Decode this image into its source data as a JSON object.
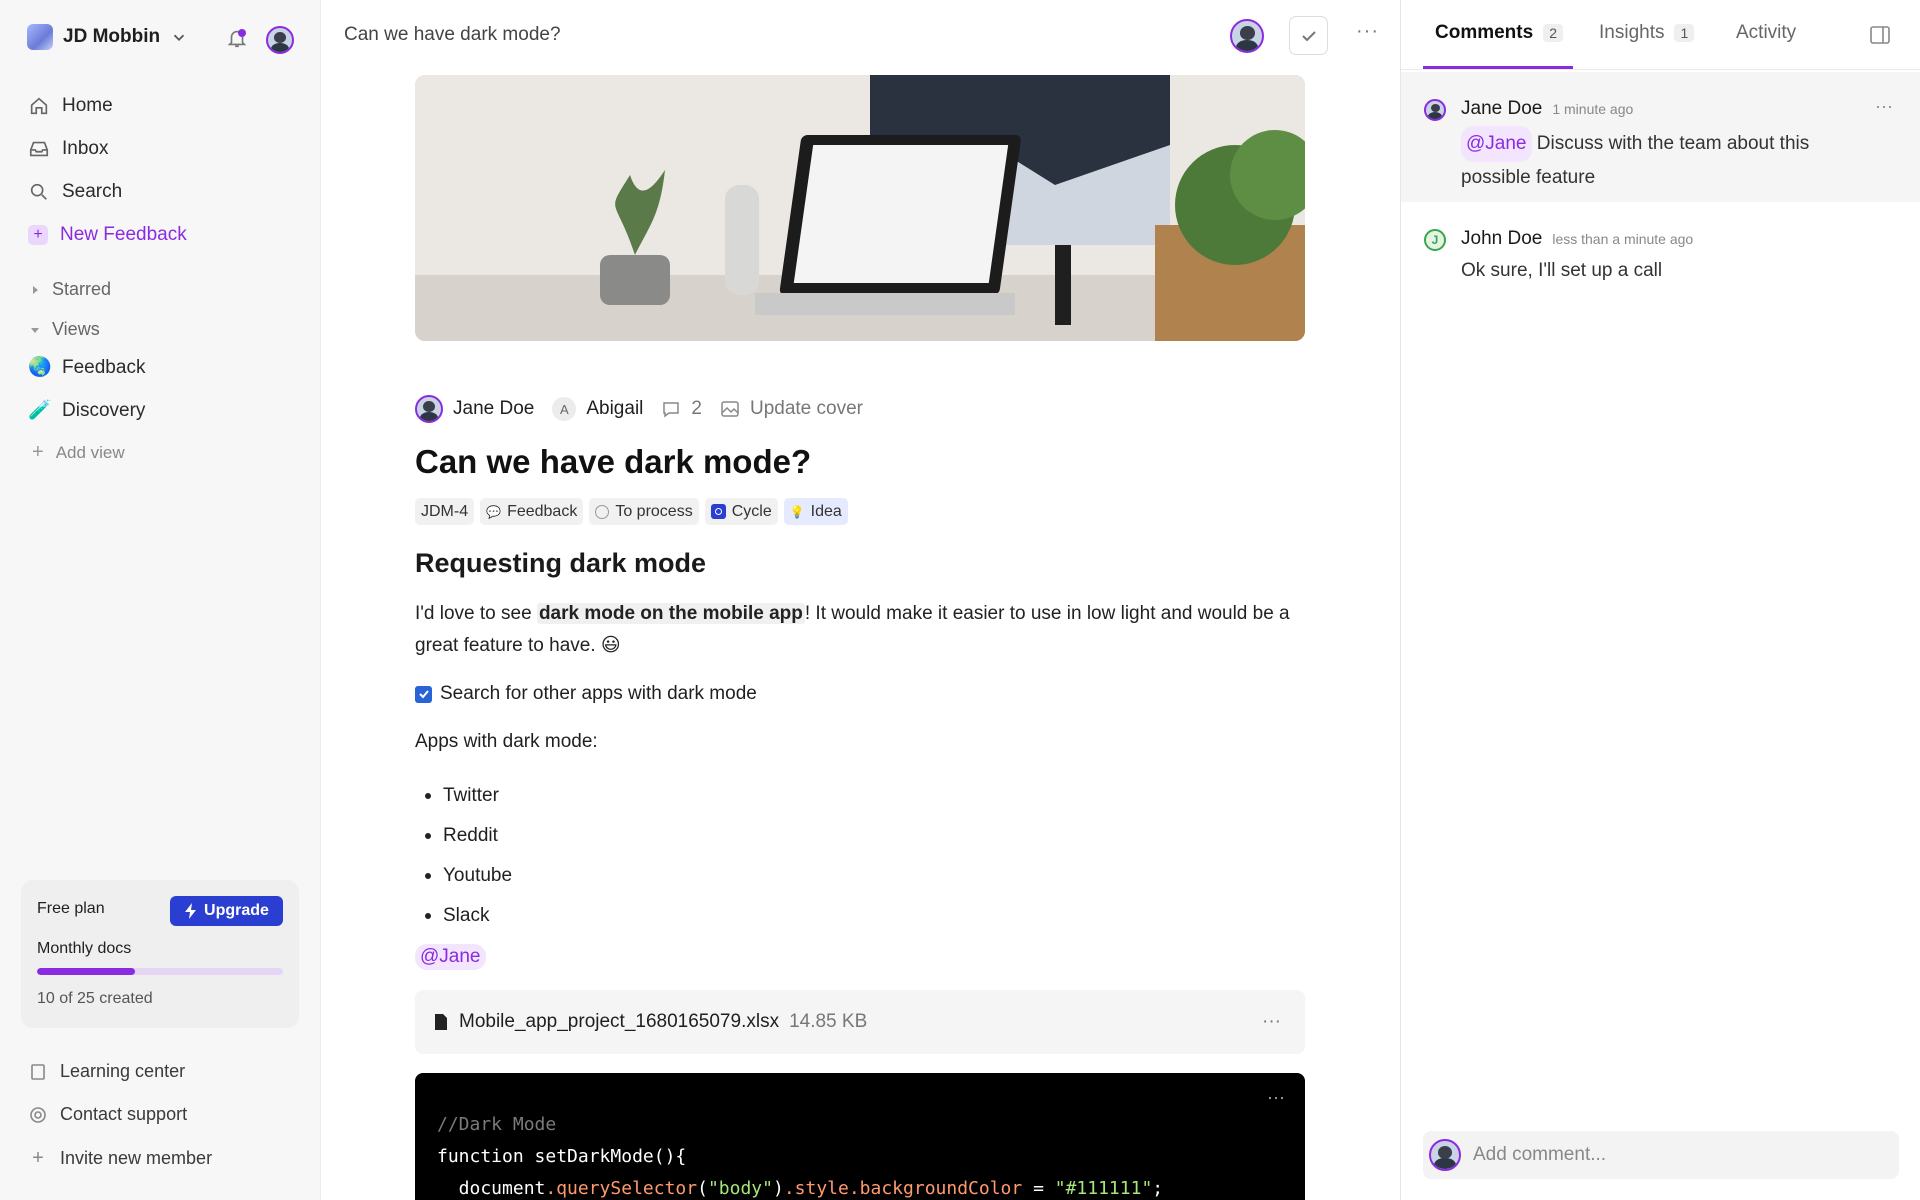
{
  "sidebar": {
    "workspace": "JD Mobbin",
    "nav": [
      {
        "label": "Home",
        "icon": "home-icon"
      },
      {
        "label": "Inbox",
        "icon": "inbox-icon"
      },
      {
        "label": "Search",
        "icon": "search-icon"
      },
      {
        "label": "New Feedback",
        "icon": "plus-icon"
      }
    ],
    "starred": "Starred",
    "views": "Views",
    "view_items": [
      {
        "label": "Feedback",
        "emoji": "🌏"
      },
      {
        "label": "Discovery",
        "emoji": "🧪"
      }
    ],
    "add_view": "Add view",
    "plan": {
      "title": "Free plan",
      "upgrade": "Upgrade",
      "label": "Monthly docs",
      "count": "10 of 25 created",
      "progress": 0.4
    },
    "footer": [
      {
        "label": "Learning center",
        "icon": "book-icon"
      },
      {
        "label": "Contact support",
        "icon": "support-icon"
      },
      {
        "label": "Invite new member",
        "icon": "plus-icon"
      }
    ]
  },
  "main": {
    "topbar_title": "Can we have dark mode?",
    "meta": {
      "author": "Jane Doe",
      "assignee_initial": "A",
      "assignee": "Abigail",
      "comments": "2",
      "cover": "Update cover"
    },
    "title": "Can we have dark mode?",
    "tags": [
      {
        "label": "JDM-4"
      },
      {
        "label": "Feedback"
      },
      {
        "label": "To process"
      },
      {
        "label": "Cycle"
      },
      {
        "label": "Idea"
      }
    ],
    "heading": "Requesting dark mode",
    "para_pre": "I'd love to see ",
    "para_bold": "dark mode on the mobile app",
    "para_post": "! It would make it easier to use in low light and would be a great feature to have. 😃",
    "todo": "Search for other apps with dark mode",
    "apps_heading": "Apps with dark mode:",
    "apps": [
      "Twitter",
      "Reddit",
      "Youtube",
      "Slack"
    ],
    "mention": "@Jane",
    "file": {
      "name": "Mobile_app_project_1680165079.xlsx",
      "size": "14.85 KB"
    },
    "code": {
      "comment": "//Dark Mode",
      "line2": "function setDarkMode(){",
      "line3_a": "  document",
      "line3_b": ".querySelector",
      "line3_c": "(",
      "line3_d": "\"body\"",
      "line3_e": ")",
      "line3_f": ".style.backgroundColor",
      "line3_g": " = ",
      "line3_h": "\"#111111\"",
      "line3_i": ";"
    }
  },
  "panel": {
    "tabs": [
      {
        "label": "Comments",
        "count": "2"
      },
      {
        "label": "Insights",
        "count": "1"
      },
      {
        "label": "Activity",
        "count": ""
      }
    ],
    "comments": [
      {
        "name": "Jane Doe",
        "time": "1 minute ago",
        "mention": "@Jane",
        "text": " Discuss with the team about this possible feature"
      },
      {
        "name": "John Doe",
        "time": "less than a minute ago",
        "initial": "J",
        "text": "Ok sure, I'll set up a call"
      }
    ],
    "add_placeholder": "Add comment..."
  }
}
